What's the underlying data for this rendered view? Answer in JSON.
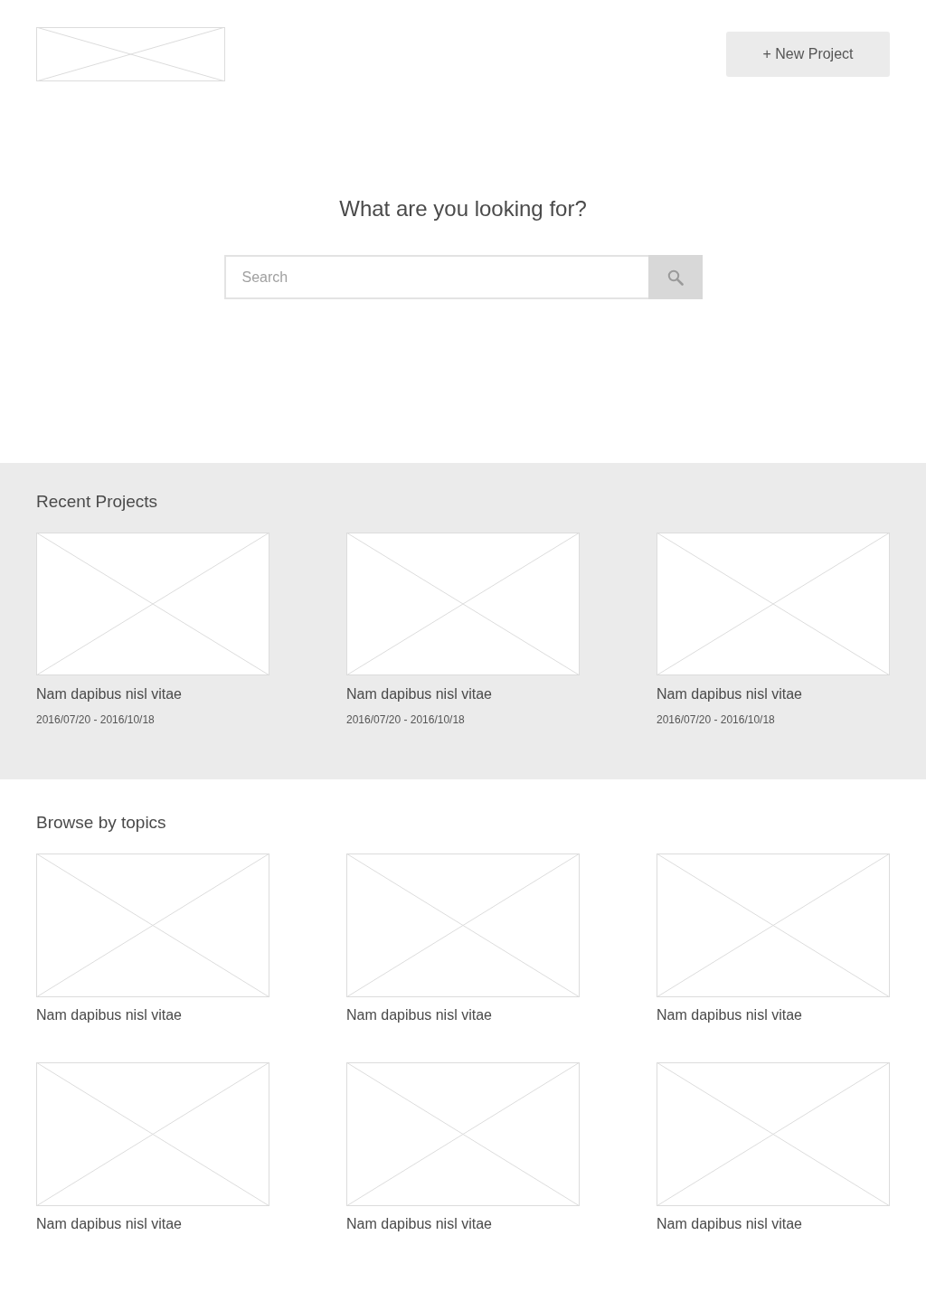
{
  "header": {
    "new_project_button": "+ New Project"
  },
  "hero": {
    "heading": "What are you looking for?",
    "search": {
      "placeholder": "Search"
    }
  },
  "recent_projects": {
    "title": "Recent Projects",
    "items": [
      {
        "name": "Nam dapibus nisl vitae",
        "dates": "2016/07/20 - 2016/10/18"
      },
      {
        "name": "Nam dapibus nisl vitae",
        "dates": "2016/07/20 - 2016/10/18"
      },
      {
        "name": "Nam dapibus nisl vitae",
        "dates": "2016/07/20 - 2016/10/18"
      }
    ]
  },
  "browse_by_topics": {
    "title": "Browse by topics",
    "items": [
      {
        "name": "Nam dapibus nisl vitae"
      },
      {
        "name": "Nam dapibus nisl vitae"
      },
      {
        "name": "Nam dapibus nisl vitae"
      },
      {
        "name": "Nam dapibus nisl vitae"
      },
      {
        "name": "Nam dapibus nisl vitae"
      },
      {
        "name": "Nam dapibus nisl vitae"
      }
    ]
  }
}
